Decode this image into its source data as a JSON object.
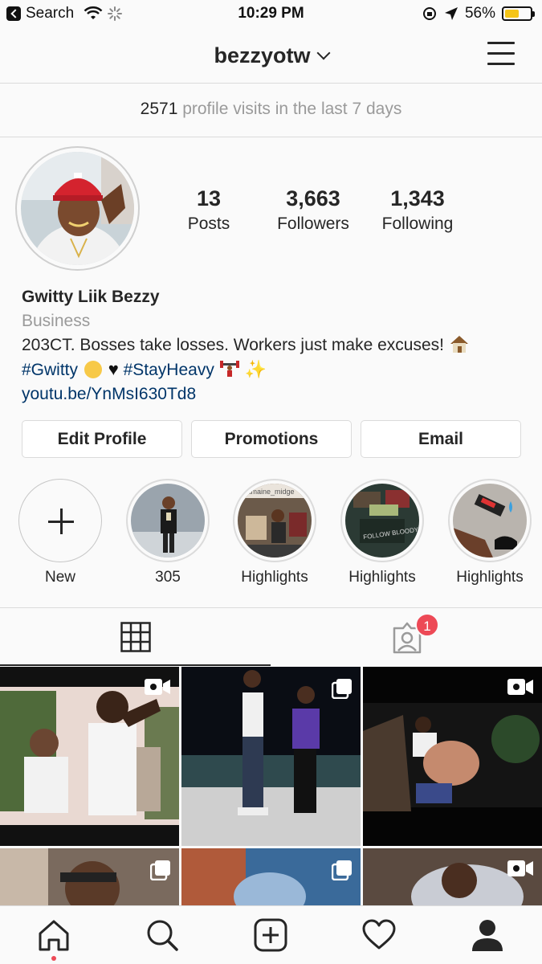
{
  "status_bar": {
    "back_label": "Search",
    "time": "10:29 PM",
    "battery": "56%",
    "battery_level": 0.56
  },
  "header": {
    "username": "bezzyotw"
  },
  "visits": {
    "count": "2571",
    "text": " profile visits in the last 7 days"
  },
  "profile": {
    "stats": [
      {
        "value": "13",
        "label": "Posts"
      },
      {
        "value": "3,663",
        "label": "Followers"
      },
      {
        "value": "1,343",
        "label": "Following"
      }
    ],
    "name": "Gwitty Liik Bezzy",
    "category": "Business",
    "bio_line1": "203CT. Bosses take losses. Workers just make excuses!",
    "hashtag1": "#Gwitty",
    "hashtag2": "#StayHeavy",
    "link": "youtu.be/YnMsI630Td8",
    "overlay_text_1": "tramaine_midge",
    "overlay_text_2": "FOLLOW BLOODY"
  },
  "buttons": {
    "edit": "Edit Profile",
    "promotions": "Promotions",
    "email": "Email"
  },
  "highlights": [
    {
      "label": "New"
    },
    {
      "label": "305"
    },
    {
      "label": "Highlights"
    },
    {
      "label": "Highlights"
    },
    {
      "label": "Highlights"
    }
  ],
  "tabs": {
    "tagged_badge": "1"
  },
  "icons": {
    "grid": "grid-icon",
    "tagged": "person-tag-icon",
    "home": "home-icon",
    "search": "search-icon",
    "add": "add-post-icon",
    "activity": "heart-icon",
    "profile": "profile-icon",
    "menu": "hamburger-menu-icon"
  },
  "colors": {
    "link": "#003569",
    "badge": "#ed4956",
    "battery": "#f5c518"
  }
}
